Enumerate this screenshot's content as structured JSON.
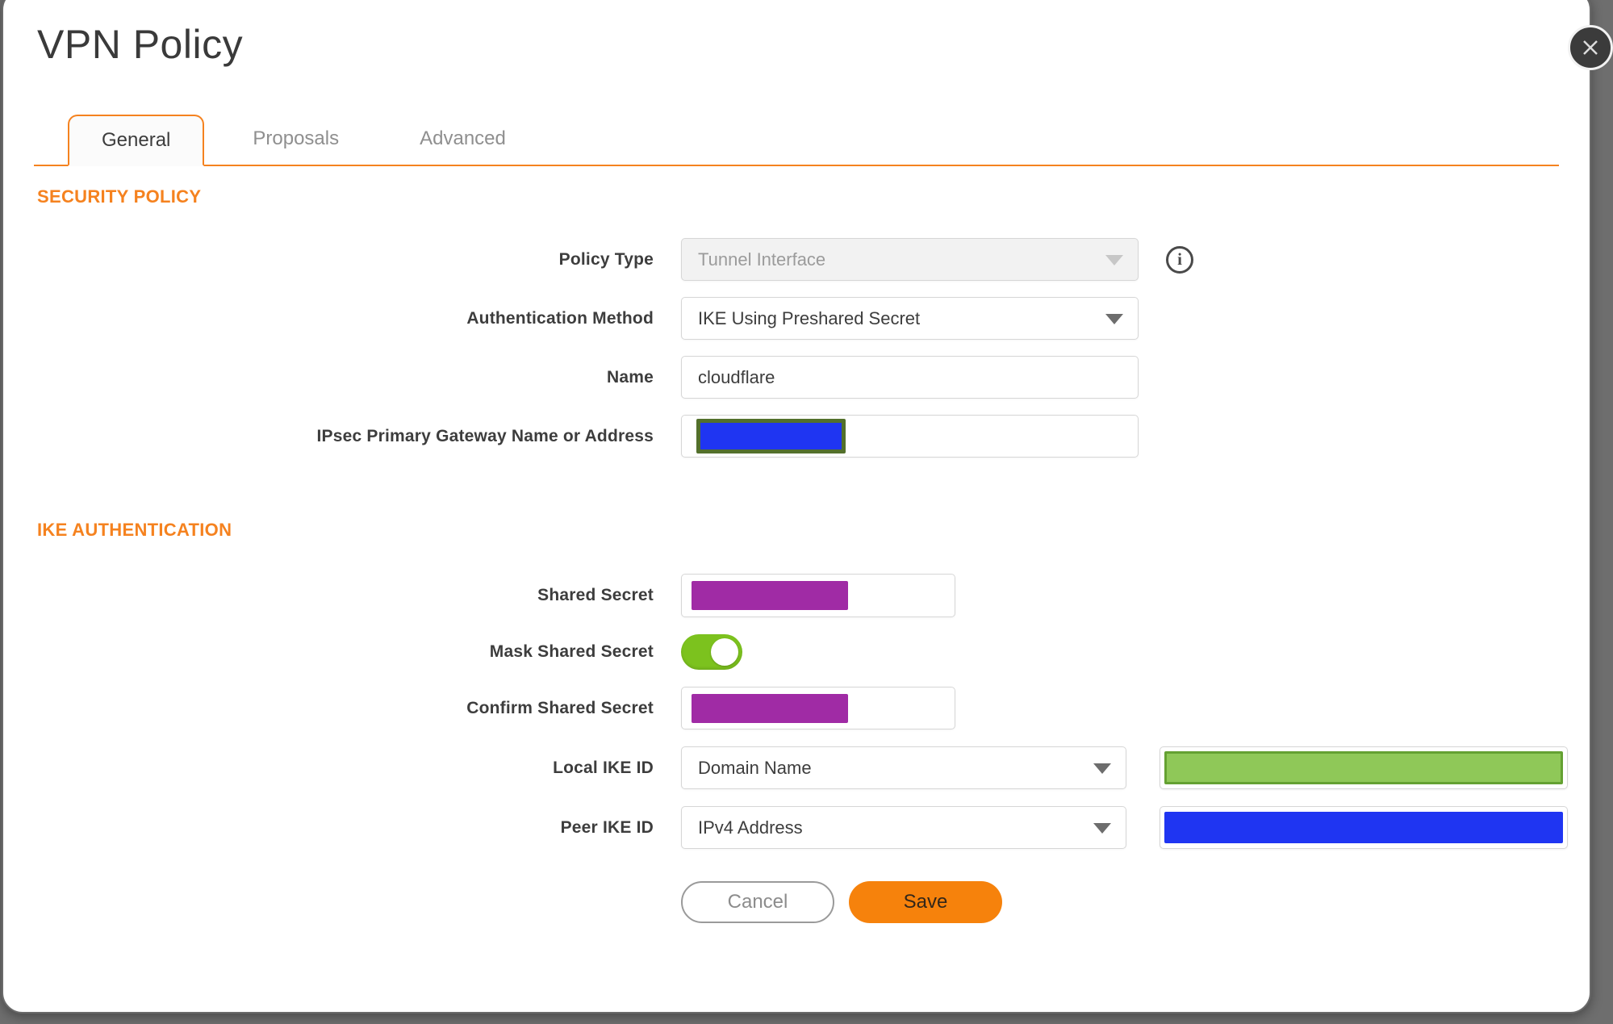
{
  "dialog": {
    "title": "VPN Policy"
  },
  "tabs": [
    {
      "label": "General",
      "active": true
    },
    {
      "label": "Proposals",
      "active": false
    },
    {
      "label": "Advanced",
      "active": false
    }
  ],
  "sections": {
    "security_policy": "SECURITY POLICY",
    "ike_authentication": "IKE AUTHENTICATION"
  },
  "fields": {
    "policy_type": {
      "label": "Policy Type",
      "value": "Tunnel Interface",
      "disabled": true
    },
    "auth_method": {
      "label": "Authentication Method",
      "value": "IKE Using Preshared Secret"
    },
    "name": {
      "label": "Name",
      "value": "cloudflare"
    },
    "gateway": {
      "label": "IPsec Primary Gateway Name or Address",
      "value": "",
      "redacted": true
    },
    "shared_secret": {
      "label": "Shared Secret",
      "value": "",
      "redacted": true
    },
    "mask_shared_secret": {
      "label": "Mask Shared Secret",
      "state": "on"
    },
    "confirm_shared_secret": {
      "label": "Confirm Shared Secret",
      "value": "",
      "redacted": true
    },
    "local_ike_id": {
      "label": "Local IKE ID",
      "value": "Domain Name",
      "id_value_redacted": true
    },
    "peer_ike_id": {
      "label": "Peer IKE ID",
      "value": "IPv4 Address",
      "id_value_redacted": true
    }
  },
  "buttons": {
    "cancel": "Cancel",
    "save": "Save"
  },
  "icons": [
    "close-icon",
    "info-icon",
    "chevron-down-icon"
  ],
  "colors": {
    "accent_orange": "#f5821f",
    "save_orange": "#f6820c",
    "toggle_green": "#7cc21e",
    "redaction_purple": "#a02ba5",
    "redaction_blue": "#1f35f2",
    "redaction_green_fill": "#8fc858",
    "redaction_green_border": "#64a132",
    "redaction_olive_border": "#53702c",
    "backdrop_gray": "#6e6e6e"
  }
}
